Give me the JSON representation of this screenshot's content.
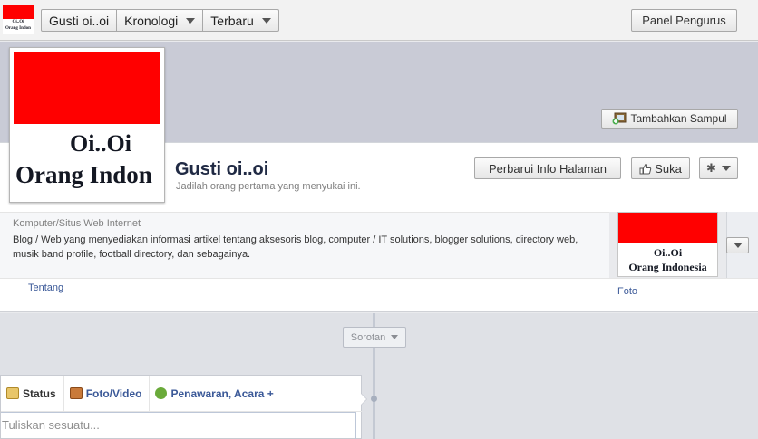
{
  "topbar": {
    "logo": {
      "line1": "Oi..Oi",
      "line2": "Orang Indon"
    },
    "nav": {
      "page_name": "Gusti oi..oi",
      "timeline": "Kronologi",
      "recent": "Terbaru"
    },
    "admin_panel": "Panel Pengurus"
  },
  "cover": {
    "add_cover": "Tambahkan Sampul",
    "profile_picture": {
      "line1": "Oi..Oi",
      "line2": "Orang Indon"
    }
  },
  "header": {
    "page_name": "Gusti oi..oi",
    "like_hint": "Jadilah orang pertama yang menyukai ini.",
    "update_info": "Perbarui Info Halaman",
    "like": "Suka"
  },
  "about": {
    "category": "Komputer/Situs Web Internet",
    "description": "Blog / Web yang menyediakan informasi artikel tentang aksesoris blog, computer / IT solutions, blogger solutions, directory web, musik band profile, football directory, dan sebagainya.",
    "about_link": "Tentang"
  },
  "photos": {
    "thumb": {
      "line1": "Oi..Oi",
      "line2": "Orang Indonesia"
    },
    "label": "Foto"
  },
  "timeline": {
    "highlights": "Sorotan"
  },
  "composer": {
    "tabs": [
      {
        "label": "Status"
      },
      {
        "label": "Foto/Video"
      },
      {
        "label": "Penawaran, Acara +"
      }
    ],
    "placeholder": "Tuliskan sesuatu..."
  },
  "colors": {
    "brand_red": "#ff0000",
    "link_blue": "#3b5998"
  }
}
